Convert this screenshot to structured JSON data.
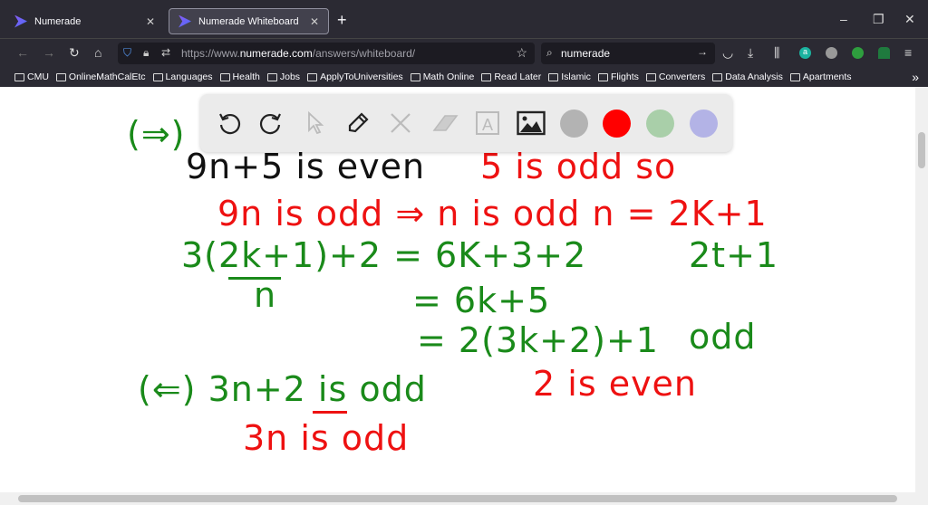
{
  "browser": {
    "tabs": [
      {
        "label": "Numerade",
        "active": false
      },
      {
        "label": "Numerade Whiteboard",
        "active": true
      }
    ],
    "url": {
      "prefix": "https://www.",
      "domain": "numerade.com",
      "path": "/answers/whiteboard/"
    },
    "search": {
      "value": "numerade"
    },
    "bookmarks": [
      "CMU",
      "OnlineMathCalEtc",
      "Languages",
      "Health",
      "Jobs",
      "ApplyToUniversities",
      "Math Online",
      "Read Later",
      "Islamic",
      "Flights",
      "Converters",
      "Data Analysis",
      "Apartments"
    ]
  },
  "toolbar": {
    "tools": [
      "undo-icon",
      "redo-icon",
      "select-icon",
      "pen-icon",
      "tools-icon",
      "eraser-icon",
      "text-icon",
      "image-icon"
    ],
    "colors": [
      "#b3b3b3",
      "#ff0000",
      "#a9cfa9",
      "#b3b3e6"
    ]
  },
  "whiteboard": {
    "lines": [
      {
        "text": "(⇒)",
        "color": "g"
      },
      {
        "text": "9n+5 is even",
        "color": "k"
      },
      {
        "text": "5 is odd so",
        "color": "r"
      },
      {
        "text": "9n is odd ⇒ n is odd   n = 2K+1",
        "color": "r"
      },
      {
        "text": "3(2k+1)+2  =  6K+3+2",
        "color": "g"
      },
      {
        "text": "2t+1",
        "color": "g"
      },
      {
        "text": "n",
        "color": "g"
      },
      {
        "text": "= 6k+5",
        "color": "g"
      },
      {
        "text": "= 2(3k+2)+1",
        "color": "g"
      },
      {
        "text": "odd",
        "color": "g"
      },
      {
        "text": "(⇐)  3n+2  is odd",
        "color": "g"
      },
      {
        "text": "2 is even",
        "color": "r"
      },
      {
        "text": "3n is odd",
        "color": "r"
      }
    ]
  }
}
